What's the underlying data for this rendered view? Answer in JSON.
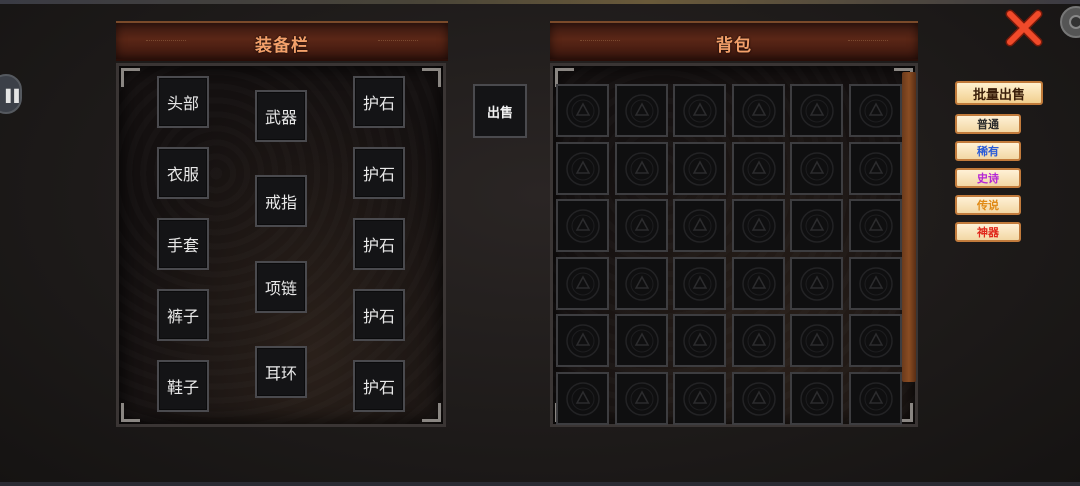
{
  "equipment_panel": {
    "title": "装备栏",
    "left_column": [
      "头部",
      "衣服",
      "手套",
      "裤子",
      "鞋子"
    ],
    "middle_column": [
      "武器",
      "戒指",
      "项链",
      "耳环"
    ],
    "right_column": [
      "护石",
      "护石",
      "护石",
      "护石",
      "护石"
    ]
  },
  "sell_button": "出售",
  "bag_panel": {
    "title": "背包",
    "rows": 6,
    "columns": 6
  },
  "bulk_sell_button": "批量出售",
  "filters": [
    {
      "label": "普通",
      "color": "#2a2a2a"
    },
    {
      "label": "稀有",
      "color": "#2a5bd7"
    },
    {
      "label": "史诗",
      "color": "#b526d6"
    },
    {
      "label": "传说",
      "color": "#e08a16"
    },
    {
      "label": "神器",
      "color": "#e0261a"
    }
  ],
  "colors": {
    "title_text": "#f3a06a",
    "close_icon": "#f04a2a"
  }
}
